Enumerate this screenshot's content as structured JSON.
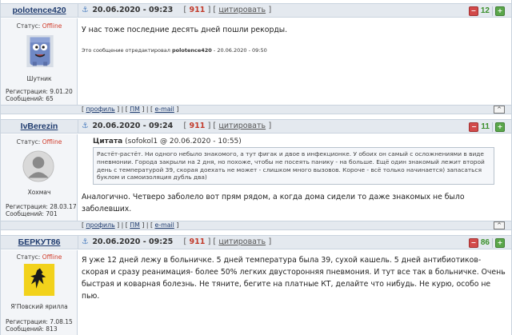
{
  "posts": [
    {
      "username": "polotence420",
      "anchor_icon": "anchor-icon",
      "datetime": "20.06.2020 - 09:23",
      "post_number": "911",
      "quote_label": "цитировать",
      "rating": {
        "value": "12"
      },
      "status_label": "Статус:",
      "status_value": "Offline",
      "avatar_caption": "Шутник",
      "registration": "Регистрация: 9.01.20",
      "messages": "Сообщений: 65",
      "text": "У нас тоже последние десять дней пошли рекорды.",
      "edited_prefix": "Это сообщение отредактировал",
      "edited_user": "polotence420",
      "edited_date": "- 20.06.2020 - 09:50",
      "footer_links": [
        "профиль",
        "ПМ",
        "e-mail"
      ],
      "up_label": "^"
    },
    {
      "username": "IvBerezin",
      "datetime": "20.06.2020 - 09:24",
      "post_number": "911",
      "quote_label": "цитировать",
      "rating": {
        "value": "11"
      },
      "status_label": "Статус:",
      "status_value": "Offline",
      "avatar_caption": "Хохмач",
      "registration": "Регистрация: 28.03.17",
      "messages": "Сообщений: 701",
      "quote_title": "Цитата",
      "quote_source": "(sofokol1 @ 20.06.2020 - 10:55)",
      "quote_text": "Растёт-растёт. Ни одного небыло знакомого, а тут фигак и двое в инфекционке. У обоих он самый с осложнениями в виде пневмонии. Города закрыли на 2 дня, но похоже, чтобы не посеять панику - на больше. Ещё один знакомый лежит второй день с температурой 39, скорая доехать не может - слишком много вызовов. Короче - всё только начинается) запасаться буклом и самоизоляция дубль два)",
      "text": "Аналогично. Четверо заболело вот прям рядом, а когда дома сидели то даже знакомых не было заболевших.",
      "footer_links": [
        "профиль",
        "ПМ",
        "e-mail"
      ],
      "up_label": "^"
    },
    {
      "username": "БЕРКУТ86",
      "datetime": "20.06.2020 - 09:25",
      "post_number": "911",
      "quote_label": "цитировать",
      "rating": {
        "value": "86"
      },
      "status_label": "Статус:",
      "status_value": "Offline",
      "avatar_caption": "Я’Повский ярилла",
      "registration": "Регистрация: 7.08.15",
      "messages": "Сообщений: 813",
      "text": "Я уже 12 дней лежу в больничке. 5 дней температура была 39, сухой кашель. 5 дней антибиотиков-скорая и сразу реанимация- более 50% легких двусторонняя пневмония. И тут все так в больничке. Очень быстрая и коварная болезнь. Не тяните, бегите на платные КТ, делайте что нибудь. Не курю, особо не пью."
    }
  ],
  "colors": {
    "header_bg": "#e4e9ef",
    "border": "#c9d3de",
    "username": "#1f3b6e",
    "offline": "#d03b2a",
    "post_number": "#c23a2a",
    "rating": "#3a8f2a"
  }
}
